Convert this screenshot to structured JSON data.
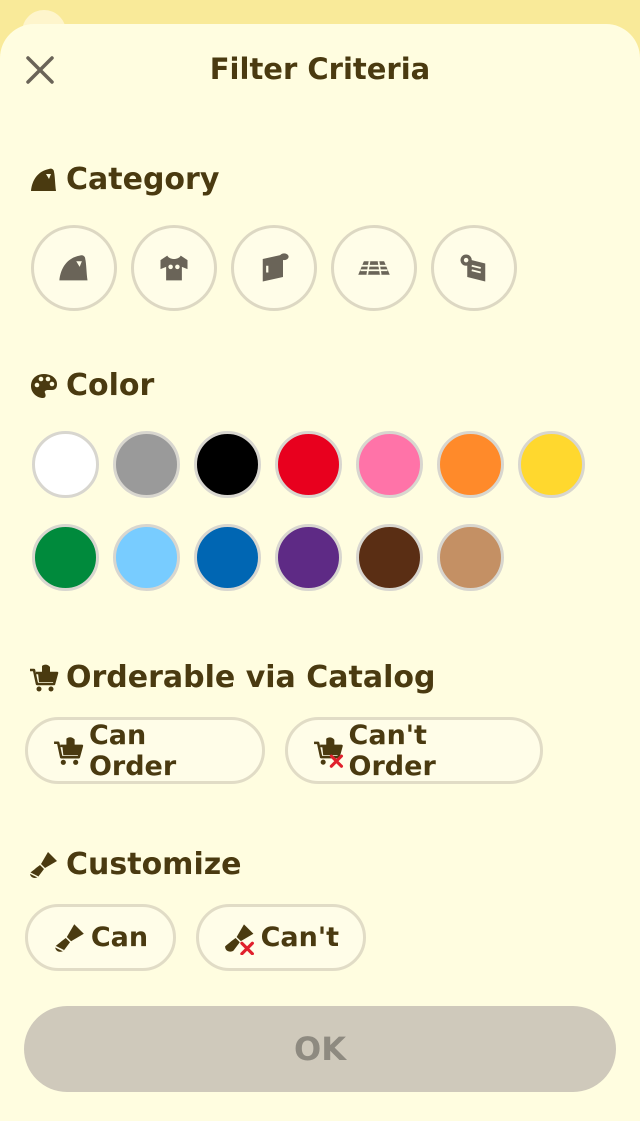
{
  "header": {
    "title": "Filter Criteria"
  },
  "category": {
    "title": "Category",
    "icons": [
      "leaf-icon",
      "shirt-icon",
      "wallpaper-icon",
      "flooring-icon",
      "rug-icon"
    ]
  },
  "color": {
    "title": "Color",
    "swatches_row1": [
      "#ffffff",
      "#9a9a9a",
      "#000000",
      "#e8001e",
      "#ff73a8",
      "#ff8a2a",
      "#ffd82e"
    ],
    "swatches_row2": [
      "#008a3c",
      "#78ccff",
      "#0066b3",
      "#5e2a85",
      "#5a2e14",
      "#c49064"
    ]
  },
  "orderable": {
    "title": "Orderable via Catalog",
    "can_label": "Can Order",
    "cant_label": "Can't Order"
  },
  "customize": {
    "title": "Customize",
    "can_label": "Can",
    "cant_label": "Can't"
  },
  "ok_label": "OK"
}
